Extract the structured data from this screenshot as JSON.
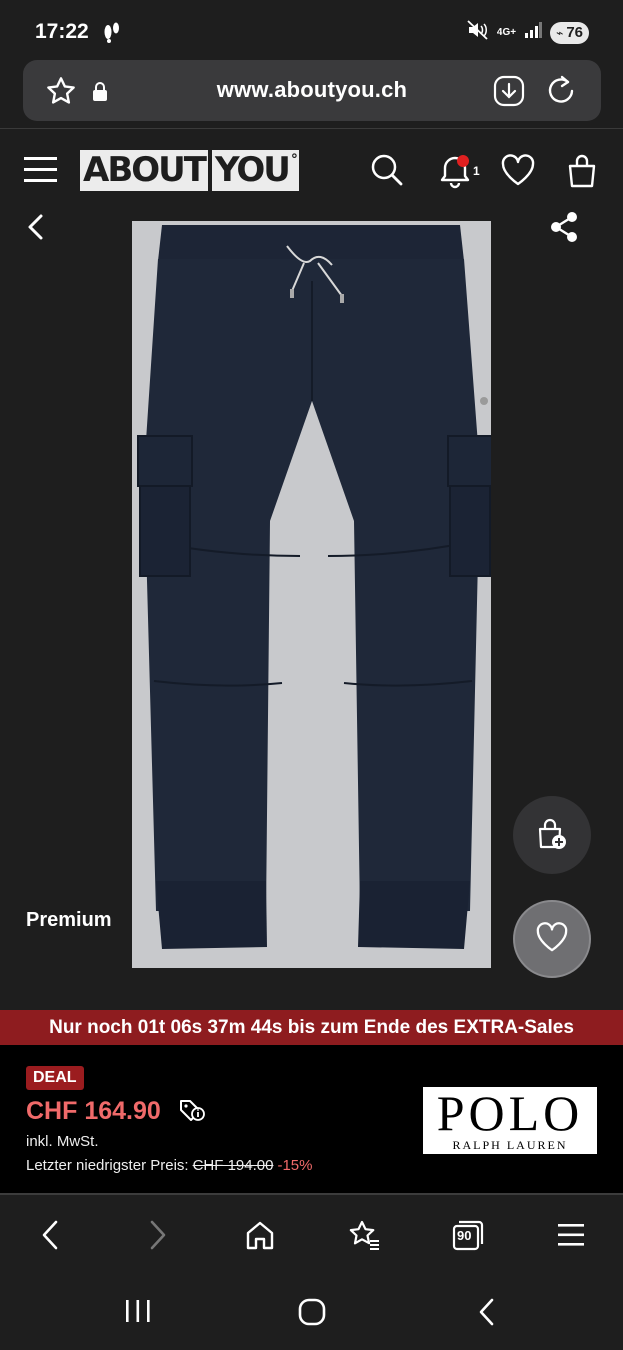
{
  "status_bar": {
    "time": "17:22",
    "network": "4G+",
    "battery": "76"
  },
  "browser": {
    "url": "www.aboutyou.ch",
    "tab_count": "90"
  },
  "site": {
    "logo_left": "ABOUT",
    "logo_right": "YOU",
    "notification_count": "1"
  },
  "product": {
    "label": "Premium",
    "brand_main": "POLO",
    "brand_sub": "RALPH LAUREN"
  },
  "sale_banner": {
    "text": "Nur noch 01t 06s 37m 44s bis zum Ende des EXTRA-Sales"
  },
  "price": {
    "badge": "DEAL",
    "current": "CHF 164.90",
    "tax_note": "inkl. MwSt.",
    "lowest_label": "Letzter niedrigster Preis:",
    "old_price": "CHF 194.00",
    "discount": "-15%"
  },
  "colors": {
    "background": "#1e1e1e",
    "sale_red": "#8e1c1f",
    "price_red": "#f06a6a",
    "product_bg": "#c8c9cc"
  }
}
